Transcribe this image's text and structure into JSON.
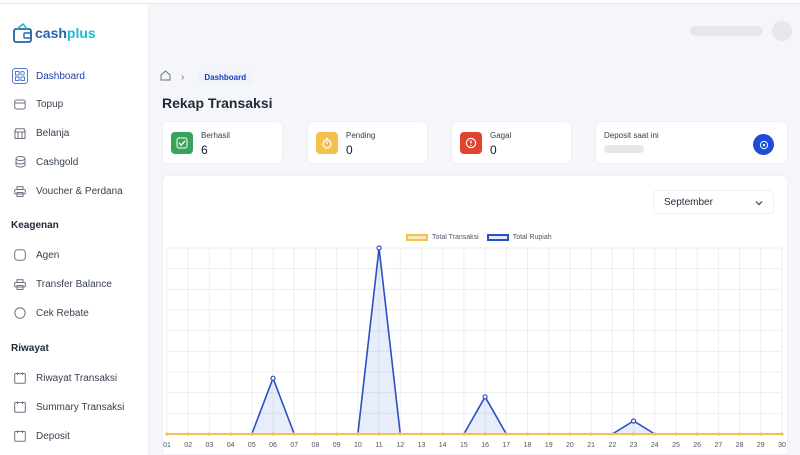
{
  "brand": {
    "part1": "cash",
    "part2": "plus"
  },
  "sidebar": {
    "items": [
      {
        "label": "Dashboard",
        "icon": "dashboard-icon",
        "active": true
      },
      {
        "label": "Topup",
        "icon": "wallet-icon"
      },
      {
        "label": "Belanja",
        "icon": "store-icon"
      },
      {
        "label": "Cashgold",
        "icon": "coins-icon"
      },
      {
        "label": "Voucher & Perdana",
        "icon": "printer-icon"
      }
    ],
    "section_keagenan": "Keagenan",
    "keagenan": [
      {
        "label": "Agen",
        "icon": "agent-icon"
      },
      {
        "label": "Transfer Balance",
        "icon": "transfer-icon"
      },
      {
        "label": "Cek Rebate",
        "icon": "rebate-icon"
      }
    ],
    "section_riwayat": "Riwayat",
    "riwayat": [
      {
        "label": "Riwayat Transaksi",
        "icon": "history-icon"
      },
      {
        "label": "Summary Transaksi",
        "icon": "summary-icon"
      },
      {
        "label": "Deposit",
        "icon": "deposit-icon"
      }
    ]
  },
  "breadcrumb": {
    "separator": "›",
    "current": "Dashboard"
  },
  "page": {
    "title": "Rekap Transaksi"
  },
  "cards": {
    "berhasil": {
      "label": "Berhasil",
      "value": "6",
      "color": "#3aa35a"
    },
    "pending": {
      "label": "Pending",
      "value": "0",
      "color": "#f2c14e"
    },
    "gagal": {
      "label": "Gagal",
      "value": "0",
      "color": "#e0442f"
    },
    "deposit": {
      "label": "Deposit saat ini",
      "button_color": "#1d4ed8"
    }
  },
  "month_select": {
    "value": "September"
  },
  "chart_data": {
    "type": "line",
    "x": [
      "01",
      "02",
      "03",
      "04",
      "05",
      "06",
      "07",
      "08",
      "09",
      "10",
      "11",
      "12",
      "13",
      "14",
      "15",
      "16",
      "17",
      "18",
      "19",
      "20",
      "21",
      "22",
      "23",
      "24",
      "25",
      "26",
      "27",
      "28",
      "29",
      "30"
    ],
    "series": [
      {
        "name": "Total Transaksi",
        "color": "#f2c14e",
        "values": [
          0,
          0,
          0,
          0,
          0,
          0,
          0,
          0,
          0,
          0,
          0,
          0,
          0,
          0,
          0,
          0,
          0,
          0,
          0,
          0,
          0,
          0,
          0,
          0,
          0,
          0,
          0,
          0,
          0,
          0
        ]
      },
      {
        "name": "Total Rupiah",
        "color": "#2c4fc4",
        "values": [
          0,
          0,
          0,
          0,
          0,
          30,
          0,
          0,
          0,
          0,
          100,
          0,
          0,
          0,
          0,
          20,
          0,
          0,
          0,
          0,
          0,
          0,
          7,
          0,
          0,
          0,
          0,
          0,
          0,
          0
        ]
      }
    ],
    "grid": true,
    "legend": "top-center"
  }
}
